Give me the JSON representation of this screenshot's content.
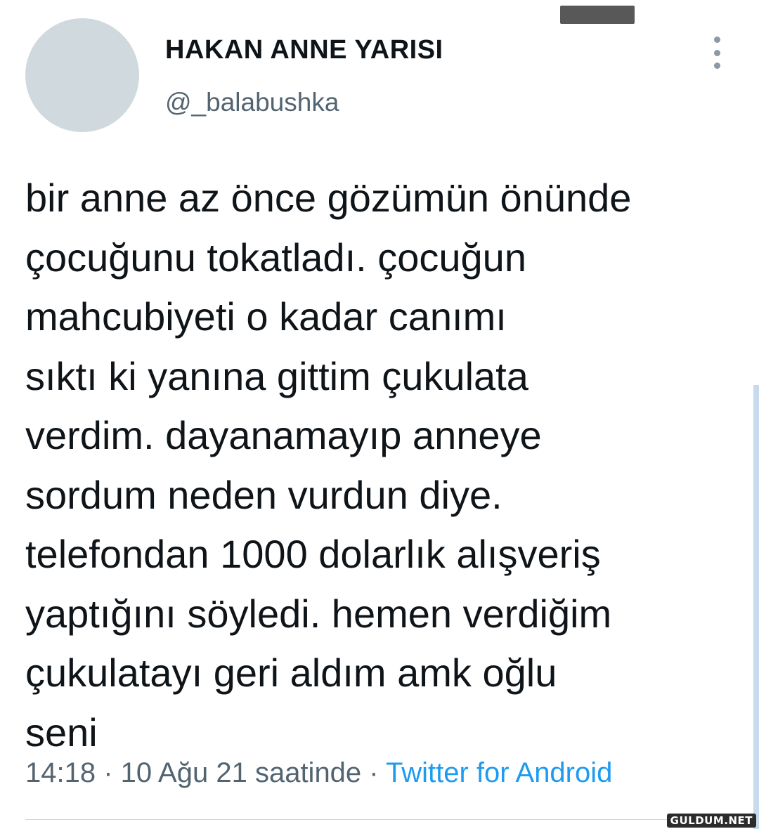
{
  "user": {
    "display_name": "HAKAN ANNE YARISI",
    "handle": "@_balabushka"
  },
  "more_icon": "more-vertical-icon",
  "tweet": {
    "lines": [
      "bir anne az önce gözümün önünde",
      "çocuğunu tokatladı. çocuğun",
      "mahcubiyeti o kadar canımı",
      "sıktı ki yanına gittim çukulata",
      "verdim. dayanamayıp anneye",
      "sordum neden vurdun diye.",
      "telefondan 1000 dolarlık alışveriş",
      "yaptığını söyledi. hemen verdiğim",
      "çukulatayı geri aldım amk oğlu",
      "seni"
    ]
  },
  "meta": {
    "time": "14:18",
    "separator": " · ",
    "date": "10 Ağu 21 saatinde",
    "source": "Twitter for Android"
  },
  "watermark": "GULDUM.NET",
  "colors": {
    "text": "#0f1419",
    "secondary": "#536471",
    "link": "#1d9bf0",
    "avatar": "#cfd9de"
  }
}
